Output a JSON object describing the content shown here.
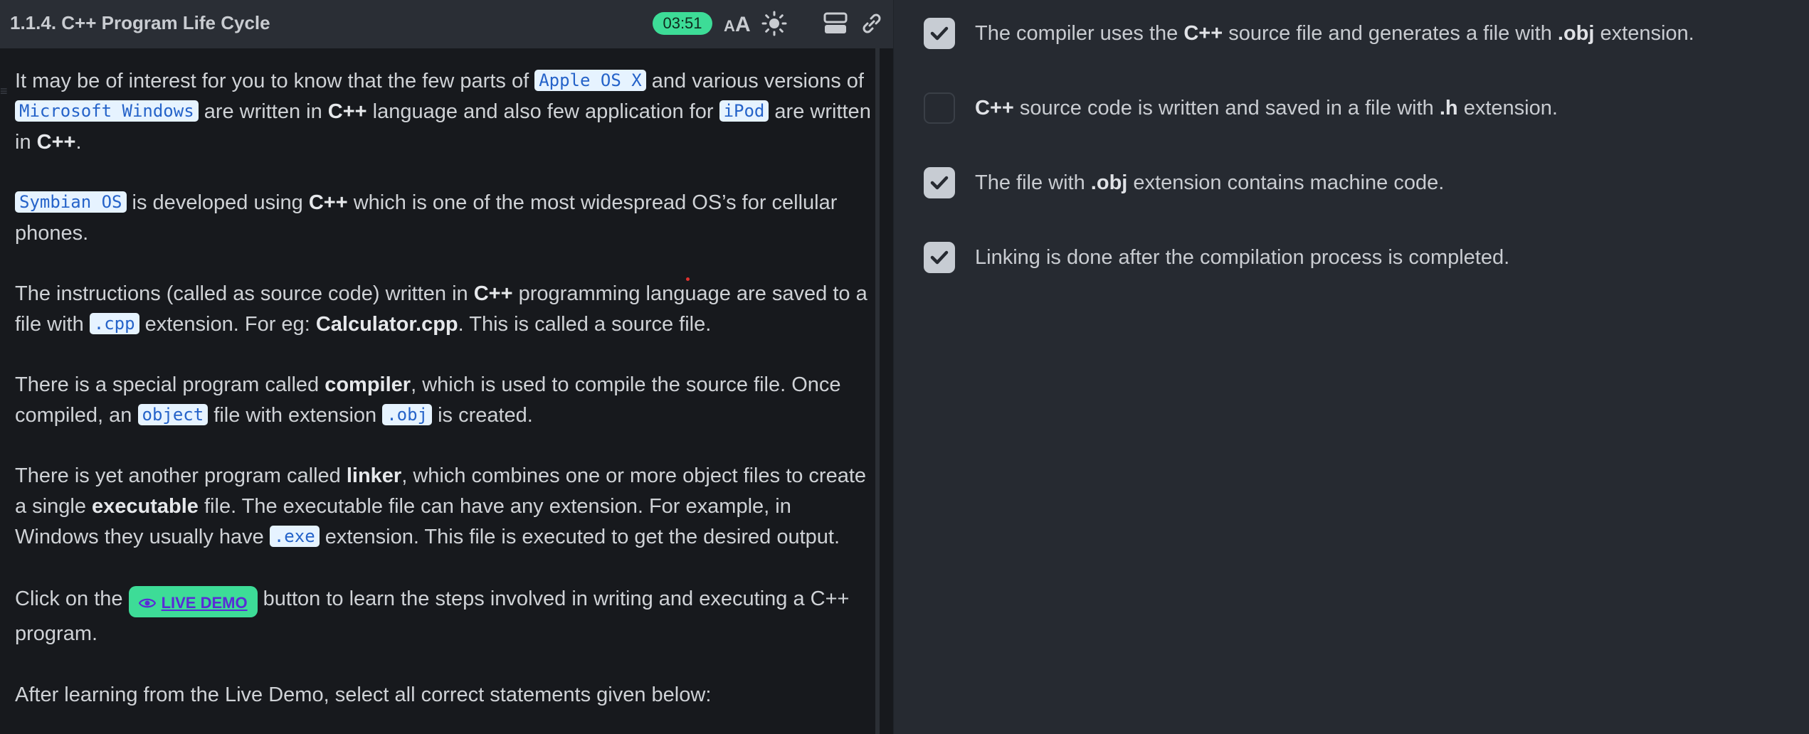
{
  "header": {
    "title": "1.1.4. C++ Program Life Cycle",
    "timer": "03:51",
    "icons": [
      "font-size-icon",
      "theme-sun-icon",
      "layout-icon",
      "link-icon"
    ]
  },
  "content": {
    "p1": {
      "t1": "It may be of interest for you to know that the few parts of ",
      "c1": "Apple OS X",
      "t2": " and various versions of ",
      "c2": "Microsoft Windows",
      "t3": " are written in ",
      "b1": "C++",
      "t4": " language and also few application for ",
      "c3": "iPod",
      "t5": " are written in ",
      "b2": "C++",
      "t6": "."
    },
    "p2": {
      "c1": "Symbian OS",
      "t1": " is developed using ",
      "b1": "C++",
      "t2": " which is one of the most widespread OS’s for cellular phones."
    },
    "p3": {
      "t1": "The instructions (called as source code) written in ",
      "b1": "C++",
      "t2": " programming language are saved to a file with ",
      "c1": ".cpp",
      "t3": " extension. For eg: ",
      "b2": "Calculator.cpp",
      "t4": ". This is called a source file."
    },
    "p4": {
      "t1": "There is a special program called ",
      "b1": "compiler",
      "t2": ", which is used to compile the source file. Once compiled, an ",
      "c1": "object",
      "t3": " file with extension ",
      "c2": ".obj",
      "t4": " is created."
    },
    "p5": {
      "t1": "There is yet another program called ",
      "b1": "linker",
      "t2": ", which combines one or more object files to create a single ",
      "b2": "executable",
      "t3": " file. The executable file can have any extension. For example, in Windows they usually have ",
      "c1": ".exe",
      "t4": " extension. This file is executed to get the desired output."
    },
    "p6": {
      "t1": "Click on the ",
      "button": "LIVE DEMO",
      "t2": " button to learn the steps involved in writing and executing a C++ program."
    },
    "p7": {
      "t1": "After learning from the Live Demo, select all correct statements given below:"
    }
  },
  "options": [
    {
      "checked": true,
      "t1": "The compiler uses the ",
      "b1": "C++",
      "t2": " source file and generates a file with ",
      "b2": ".obj",
      "t3": " extension."
    },
    {
      "checked": false,
      "t1": "",
      "b1": "C++",
      "t2": " source code is written and saved in a file with ",
      "b2": ".h",
      "t3": " extension."
    },
    {
      "checked": true,
      "t1": "The file with ",
      "b1": ".obj",
      "t2": " extension contains machine code.",
      "b2": "",
      "t3": ""
    },
    {
      "checked": true,
      "t1": "Linking is done after the compilation process is completed.",
      "b1": "",
      "t2": "",
      "b2": "",
      "t3": ""
    }
  ],
  "colors": {
    "accent_green": "#3ddc97",
    "code_bg": "#e6f3ff",
    "code_text": "#2563c9",
    "left_bg": "#17191d",
    "right_bg": "#262a31"
  }
}
